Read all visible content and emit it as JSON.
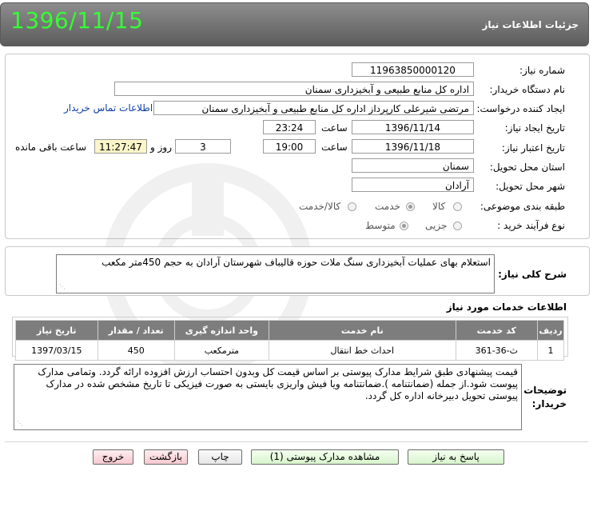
{
  "header": {
    "title": "جزئیات اطلاعات نیاز",
    "date": "1396/11/15"
  },
  "form": {
    "need_number_label": "شماره نیاز:",
    "need_number": "11963850000120",
    "buyer_org_label": "نام دستگاه خریدار:",
    "buyer_org": "اداره کل منابع طبیعی و آبخیزداری سمنان",
    "requester_label": "ایجاد کننده درخواست:",
    "requester": "مرتضی شیرعلی کارپرداز اداره کل منابع طبیعی و آبخیزداری سمنان",
    "contact_link": "اطلاعات تماس خریدار",
    "created_label": "تاریخ ایجاد نیاز:",
    "created_date": "1396/11/14",
    "time_label": "ساعت",
    "created_time": "23:24",
    "validity_label": "تاریخ اعتبار نیاز:",
    "validity_date": "1396/11/18",
    "validity_time": "19:00",
    "days_value": "3",
    "days_label": "روز و",
    "remaining_time": "11:27:47",
    "remaining_label": "ساعت باقی مانده",
    "province_label": "استان محل تحویل:",
    "province": "سمنان",
    "city_label": "شهر محل تحویل:",
    "city": "آرادان",
    "category_label": "طبقه بندی موضوعی:",
    "category_options": [
      "کالا",
      "خدمت",
      "کالا/خدمت"
    ],
    "category_selected": "خدمت",
    "process_label": "نوع فرآیند خرید :",
    "process_options": [
      "جزیی",
      "متوسط"
    ],
    "process_selected": "متوسط"
  },
  "description": {
    "label": "شرح کلی نیاز:",
    "text": "استعلام بهای عملیات آبخیزداری  سنگ ملات حوزه قالیباف شهرستان آرادان به حجم 450متر مکعب"
  },
  "services": {
    "title": "اطلاعات خدمات مورد نیاز",
    "columns": [
      "ردیف",
      "کد خدمت",
      "نام خدمت",
      "واحد اندازه گیری",
      "تعداد / مقدار",
      "تاریخ نیاز"
    ],
    "rows": [
      {
        "row": "1",
        "code": "ث-36-361",
        "name": "احداث خط انتقال",
        "unit": "مترمکعب",
        "qty": "450",
        "date": "1397/03/15"
      }
    ]
  },
  "buyer_notes": {
    "label": "توضیحات خریدار:",
    "text": "قیمت پیشنهادی  طبق شرایط مدارک پیوستی بر اساس قیمت کل وبدون احتساب ارزش افزوده ارائه گردد. وتمامی مدارک پیوست شود.از جمله (ضمانتنامه ).ضمانتنامه ویا فیش واریزی بایستی به صورت فیزیکی تا تاریخ مشخص شده در مدارک پیوستی تحویل دبیرخانه اداره کل گردد."
  },
  "buttons": {
    "reply": "پاسخ به نیاز",
    "view_docs": "مشاهده مدارک پیوستی (1)",
    "print": "چاپ",
    "back": "بازگشت",
    "exit": "خروج"
  },
  "colors": {
    "header_gray": "#7a7a7a",
    "date_green": "#33ff33",
    "link_blue": "#0b3fa8",
    "remaining_bg": "#fbf5c8"
  }
}
